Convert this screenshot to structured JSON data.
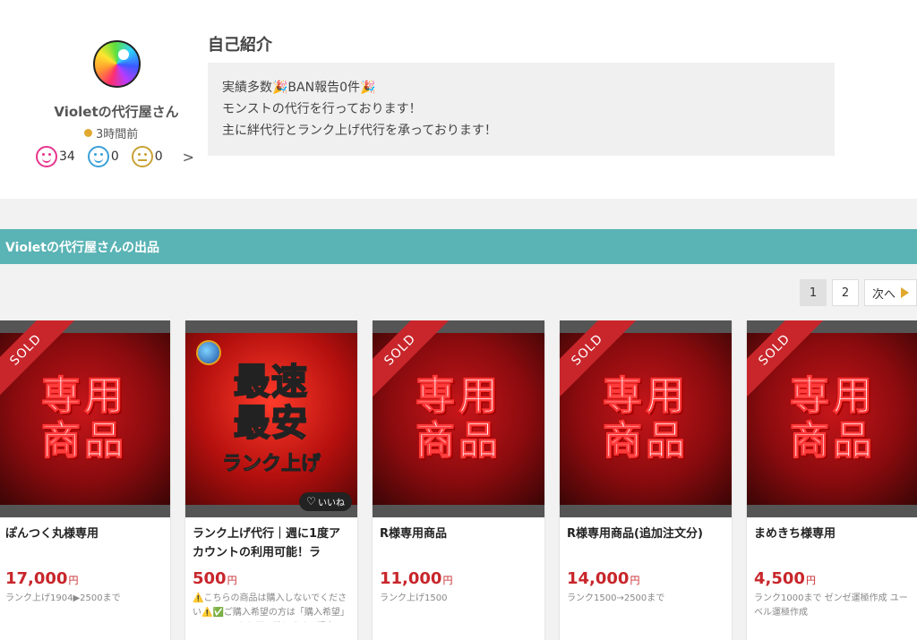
{
  "profile": {
    "shop_name": "Violetの代行屋さん",
    "last_seen": "3時間前",
    "ratings": {
      "good": "34",
      "normal": "0",
      "bad": "0"
    },
    "more": ">"
  },
  "intro": {
    "title": "自己紹介",
    "lines": [
      "実績多数🎉BAN報告0件🎉",
      "モンストの代行を行っております！",
      "主に絆代行とランク上げ代行を承っております！"
    ]
  },
  "listing": {
    "section_title": "Violetの代行屋さんの出品",
    "pagination": {
      "page1": "1",
      "page2": "2",
      "next": "次へ"
    },
    "products": [
      {
        "title": "ぽんつく丸様専用",
        "price": "17,000",
        "currency": "円",
        "note": "ランク上げ1904▶2500まで",
        "sold": "SOLD",
        "image_text": [
          "専用",
          "商品"
        ]
      },
      {
        "title": "ランク上げ代行｜週に1度アカウントの利用可能！ラ",
        "price": "500",
        "currency": "円",
        "note": "⚠️こちらの商品は購入しないでください⚠️✅ご購入希望の方は「購入希望」とコメントをお願い致します。現在の",
        "image_text": [
          "最速",
          "最安",
          "ランク上げ"
        ],
        "like": "いいね"
      },
      {
        "title": "R様専用商品",
        "price": "11,000",
        "currency": "円",
        "note": "ランク上げ1500",
        "sold": "SOLD",
        "image_text": [
          "専用",
          "商品"
        ]
      },
      {
        "title": "R様専用商品(追加注文分)",
        "price": "14,000",
        "currency": "円",
        "note": "ランク1500→2500まで",
        "sold": "SOLD",
        "image_text": [
          "専用",
          "商品"
        ]
      },
      {
        "title": "まめきち様専用",
        "price": "4,500",
        "currency": "円",
        "note": "ランク1000まで ゼンゼ運極作成 ユーベル運極作成",
        "sold": "SOLD",
        "image_text": [
          "専用",
          "商品"
        ]
      }
    ]
  },
  "colors": {
    "accent_bar": "#5ab3b5",
    "price": "#c8262b",
    "sold_ribbon": "#c8262b"
  }
}
